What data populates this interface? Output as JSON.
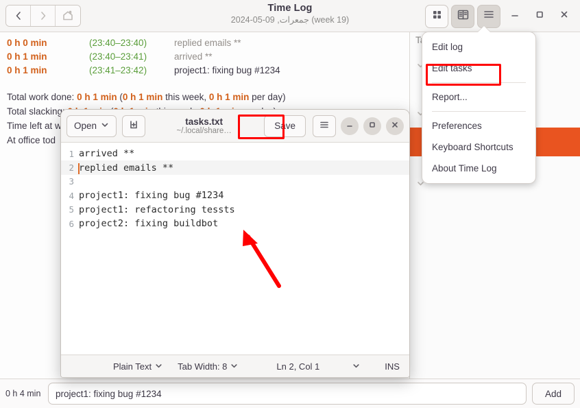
{
  "app": {
    "title": "Time Log",
    "subtitle": "جمعرات, 09-05-2024 (week 19)"
  },
  "nav": {
    "back_icon": "chevron-left-icon",
    "forward_icon": "chevron-right-icon",
    "home_icon": "home-icon"
  },
  "header_buttons": {
    "grid_view": "grid-view-icon",
    "reading_view": "reading-view-icon",
    "menu": "hamburger-menu-icon",
    "minimize": "minimize-icon",
    "maximize": "maximize-icon",
    "close": "close-icon"
  },
  "log": {
    "entries": [
      {
        "duration": "0 h 0 min",
        "range": "(23:40–23:40)",
        "description": "replied emails **",
        "dim": true
      },
      {
        "duration": "0 h 1 min",
        "range": "(23:40–23:41)",
        "description": "arrived **",
        "dim": true
      },
      {
        "duration": "0 h 1 min",
        "range": "(23:41–23:42)",
        "description": "project1: fixing bug #1234",
        "dim": false
      }
    ],
    "summary": [
      {
        "prefix": "Total work done: ",
        "value": "0 h 1 min",
        "mid": " (",
        "value2": "0 h 1 min",
        "suffix2": " this week, ",
        "value3": "0 h 1 min",
        "suffix3": " per day)"
      },
      {
        "prefix": "Total slacking: ",
        "value": "0 h 1 min",
        "mid": " (",
        "value2": "0 h 1 min",
        "suffix2": " this week, ",
        "value3": "0 h 1 min",
        "suffix3": " per day)"
      }
    ],
    "truncated_lines": [
      "Time left at w",
      "At office tod"
    ]
  },
  "sidebar": {
    "title": "Tasks",
    "rows": [
      "",
      "",
      "",
      ""
    ]
  },
  "menu": {
    "items": [
      {
        "label": "Edit log",
        "type": "item"
      },
      {
        "label": "Edit tasks",
        "type": "item",
        "highlighted": true
      },
      {
        "type": "separator"
      },
      {
        "label": "Report...",
        "type": "item"
      },
      {
        "type": "separator"
      },
      {
        "label": "Preferences",
        "type": "item"
      },
      {
        "label": "Keyboard Shortcuts",
        "type": "item"
      },
      {
        "label": "About Time Log",
        "type": "item"
      }
    ]
  },
  "editor": {
    "open_label": "Open",
    "open_chevron": "chevron-down-icon",
    "new_tab_icon": "new-document-icon",
    "file_name": "tasks.txt",
    "file_path": "~/.local/share…",
    "save_label": "Save",
    "menu_icon": "hamburger-menu-icon",
    "minimize": "minimize-icon",
    "maximize": "maximize-icon",
    "close": "close-icon",
    "lines": [
      {
        "n": "1",
        "text": "arrived **",
        "current": false
      },
      {
        "n": "2",
        "text": "replied emails **",
        "current": true
      },
      {
        "n": "3",
        "text": "",
        "current": false
      },
      {
        "n": "4",
        "text": "project1: fixing bug #1234",
        "current": false
      },
      {
        "n": "5",
        "text": "project1: refactoring tessts",
        "current": false
      },
      {
        "n": "6",
        "text": "project2: fixing buildbot",
        "current": false
      }
    ],
    "status": {
      "language": "Plain Text",
      "tab_width": "Tab Width: 8",
      "position": "Ln 2, Col 1",
      "insert_mode": "INS"
    }
  },
  "bottom": {
    "duration": "0 h 4 min",
    "input_value": "project1: fixing bug #1234",
    "add_label": "Add"
  },
  "colors": {
    "accent_orange": "#e95420",
    "duration_orange": "#d2601a",
    "time_green": "#5a9e3a",
    "annotation_red": "#ff0000"
  }
}
